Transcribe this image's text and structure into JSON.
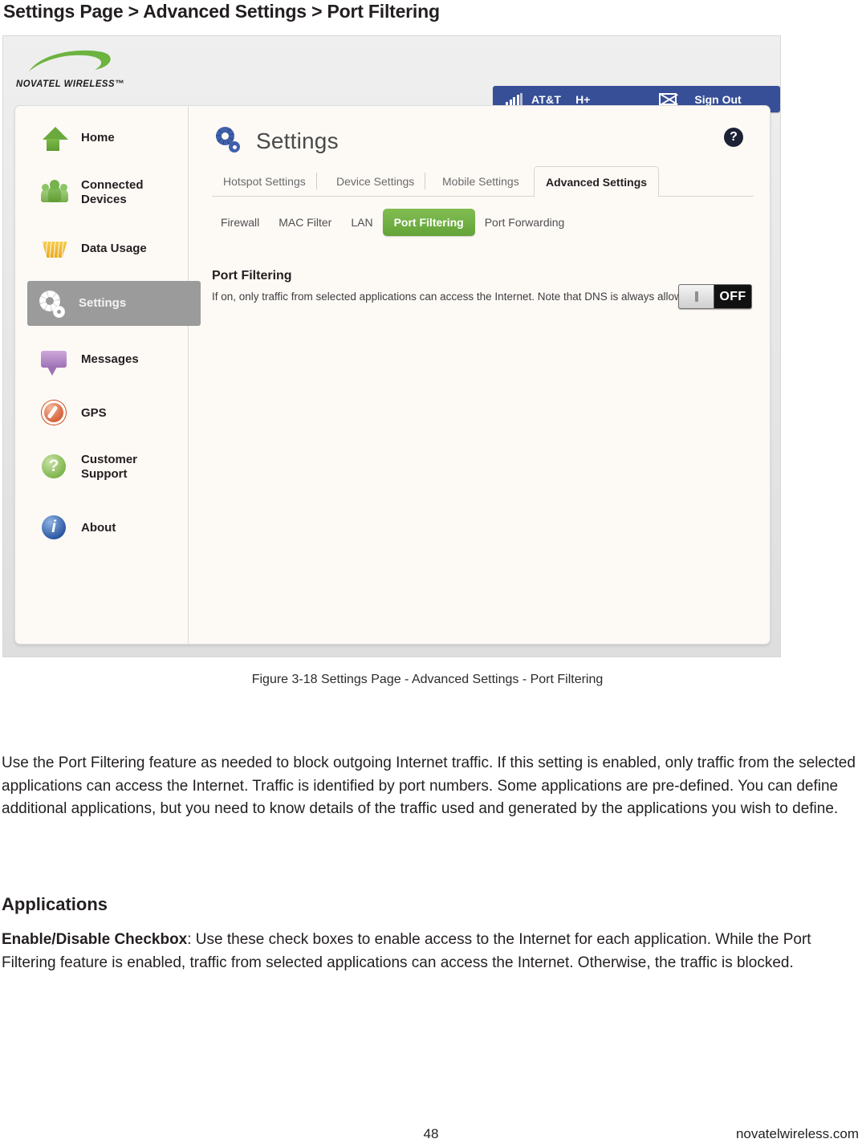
{
  "document": {
    "heading": "Settings Page > Advanced Settings > Port Filtering",
    "figure_caption": "Figure 3-18 Settings Page - Advanced Settings - Port Filtering",
    "paragraph_1": "Use the Port Filtering feature as needed to block outgoing Internet traffic. If this setting is enabled, only traffic from the selected applications can access the Internet. Traffic is identified by port numbers. Some applications are pre-defined. You can define additional applications, but you need to know details of the traffic used and generated by the applications you wish to define.",
    "section_heading": "Applications",
    "checkbox_term": "Enable/Disable Checkbox",
    "checkbox_description": ": Use these check boxes to enable access to the Internet for each application. While the Port Filtering feature is enabled, traffic from selected applications can access the Internet. Otherwise, the traffic is blocked.",
    "page_number": "48",
    "website": "novatelwireless.com"
  },
  "screenshot": {
    "brand": {
      "name": "NOVATEL WIRELESS",
      "trademark": "™",
      "swoosh_color": "#6cb33f"
    },
    "status_bar": {
      "signal_icon": "signal-bars-icon",
      "carrier": "AT&T",
      "network_type": "H+",
      "battery_icon": "battery-empty-icon",
      "sign_out": "Sign Out",
      "background_color": "#364f96"
    },
    "sidebar": {
      "items": [
        {
          "label": "Home",
          "icon": "home-icon",
          "active": false
        },
        {
          "label": "Connected Devices",
          "icon": "connected-devices-icon",
          "active": false
        },
        {
          "label": "Data Usage",
          "icon": "data-usage-icon",
          "active": false
        },
        {
          "label": "Settings",
          "icon": "gear-icon",
          "active": true
        },
        {
          "label": "Messages",
          "icon": "message-bubble-icon",
          "active": false
        },
        {
          "label": "GPS",
          "icon": "compass-icon",
          "active": false
        },
        {
          "label": "Customer Support",
          "icon": "question-circle-icon",
          "active": false
        },
        {
          "label": "About",
          "icon": "info-circle-icon",
          "active": false
        }
      ],
      "active_background": "#9b9b9b"
    },
    "pane": {
      "title": "Settings",
      "title_icon": "gear-icon",
      "help_icon": "help-question-icon",
      "tabs": [
        {
          "label": "Hotspot Settings",
          "active": false
        },
        {
          "label": "Device Settings",
          "active": false
        },
        {
          "label": "Mobile Settings",
          "active": false
        },
        {
          "label": "Advanced Settings",
          "active": true
        }
      ],
      "subtabs": [
        {
          "label": "Firewall",
          "active": false
        },
        {
          "label": "MAC Filter",
          "active": false
        },
        {
          "label": "LAN",
          "active": false
        },
        {
          "label": "Port Filtering",
          "active": true
        },
        {
          "label": "Port Forwarding",
          "active": false
        }
      ],
      "active_subtab_color": "#6fb648"
    },
    "section": {
      "title": "Port Filtering",
      "description": "If on, only traffic from selected applications can access the Internet. Note that DNS is always allowed.",
      "toggle_state": "OFF"
    }
  }
}
